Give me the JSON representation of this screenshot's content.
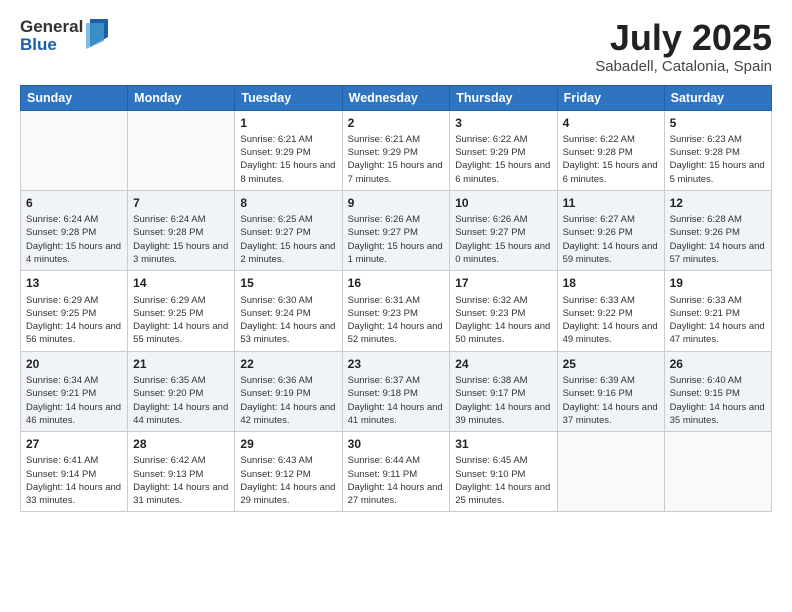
{
  "logo": {
    "general": "General",
    "blue": "Blue"
  },
  "title": {
    "month_year": "July 2025",
    "location": "Sabadell, Catalonia, Spain"
  },
  "headers": [
    "Sunday",
    "Monday",
    "Tuesday",
    "Wednesday",
    "Thursday",
    "Friday",
    "Saturday"
  ],
  "weeks": [
    [
      {
        "day": "",
        "info": ""
      },
      {
        "day": "",
        "info": ""
      },
      {
        "day": "1",
        "info": "Sunrise: 6:21 AM\nSunset: 9:29 PM\nDaylight: 15 hours and 8 minutes."
      },
      {
        "day": "2",
        "info": "Sunrise: 6:21 AM\nSunset: 9:29 PM\nDaylight: 15 hours and 7 minutes."
      },
      {
        "day": "3",
        "info": "Sunrise: 6:22 AM\nSunset: 9:29 PM\nDaylight: 15 hours and 6 minutes."
      },
      {
        "day": "4",
        "info": "Sunrise: 6:22 AM\nSunset: 9:28 PM\nDaylight: 15 hours and 6 minutes."
      },
      {
        "day": "5",
        "info": "Sunrise: 6:23 AM\nSunset: 9:28 PM\nDaylight: 15 hours and 5 minutes."
      }
    ],
    [
      {
        "day": "6",
        "info": "Sunrise: 6:24 AM\nSunset: 9:28 PM\nDaylight: 15 hours and 4 minutes."
      },
      {
        "day": "7",
        "info": "Sunrise: 6:24 AM\nSunset: 9:28 PM\nDaylight: 15 hours and 3 minutes."
      },
      {
        "day": "8",
        "info": "Sunrise: 6:25 AM\nSunset: 9:27 PM\nDaylight: 15 hours and 2 minutes."
      },
      {
        "day": "9",
        "info": "Sunrise: 6:26 AM\nSunset: 9:27 PM\nDaylight: 15 hours and 1 minute."
      },
      {
        "day": "10",
        "info": "Sunrise: 6:26 AM\nSunset: 9:27 PM\nDaylight: 15 hours and 0 minutes."
      },
      {
        "day": "11",
        "info": "Sunrise: 6:27 AM\nSunset: 9:26 PM\nDaylight: 14 hours and 59 minutes."
      },
      {
        "day": "12",
        "info": "Sunrise: 6:28 AM\nSunset: 9:26 PM\nDaylight: 14 hours and 57 minutes."
      }
    ],
    [
      {
        "day": "13",
        "info": "Sunrise: 6:29 AM\nSunset: 9:25 PM\nDaylight: 14 hours and 56 minutes."
      },
      {
        "day": "14",
        "info": "Sunrise: 6:29 AM\nSunset: 9:25 PM\nDaylight: 14 hours and 55 minutes."
      },
      {
        "day": "15",
        "info": "Sunrise: 6:30 AM\nSunset: 9:24 PM\nDaylight: 14 hours and 53 minutes."
      },
      {
        "day": "16",
        "info": "Sunrise: 6:31 AM\nSunset: 9:23 PM\nDaylight: 14 hours and 52 minutes."
      },
      {
        "day": "17",
        "info": "Sunrise: 6:32 AM\nSunset: 9:23 PM\nDaylight: 14 hours and 50 minutes."
      },
      {
        "day": "18",
        "info": "Sunrise: 6:33 AM\nSunset: 9:22 PM\nDaylight: 14 hours and 49 minutes."
      },
      {
        "day": "19",
        "info": "Sunrise: 6:33 AM\nSunset: 9:21 PM\nDaylight: 14 hours and 47 minutes."
      }
    ],
    [
      {
        "day": "20",
        "info": "Sunrise: 6:34 AM\nSunset: 9:21 PM\nDaylight: 14 hours and 46 minutes."
      },
      {
        "day": "21",
        "info": "Sunrise: 6:35 AM\nSunset: 9:20 PM\nDaylight: 14 hours and 44 minutes."
      },
      {
        "day": "22",
        "info": "Sunrise: 6:36 AM\nSunset: 9:19 PM\nDaylight: 14 hours and 42 minutes."
      },
      {
        "day": "23",
        "info": "Sunrise: 6:37 AM\nSunset: 9:18 PM\nDaylight: 14 hours and 41 minutes."
      },
      {
        "day": "24",
        "info": "Sunrise: 6:38 AM\nSunset: 9:17 PM\nDaylight: 14 hours and 39 minutes."
      },
      {
        "day": "25",
        "info": "Sunrise: 6:39 AM\nSunset: 9:16 PM\nDaylight: 14 hours and 37 minutes."
      },
      {
        "day": "26",
        "info": "Sunrise: 6:40 AM\nSunset: 9:15 PM\nDaylight: 14 hours and 35 minutes."
      }
    ],
    [
      {
        "day": "27",
        "info": "Sunrise: 6:41 AM\nSunset: 9:14 PM\nDaylight: 14 hours and 33 minutes."
      },
      {
        "day": "28",
        "info": "Sunrise: 6:42 AM\nSunset: 9:13 PM\nDaylight: 14 hours and 31 minutes."
      },
      {
        "day": "29",
        "info": "Sunrise: 6:43 AM\nSunset: 9:12 PM\nDaylight: 14 hours and 29 minutes."
      },
      {
        "day": "30",
        "info": "Sunrise: 6:44 AM\nSunset: 9:11 PM\nDaylight: 14 hours and 27 minutes."
      },
      {
        "day": "31",
        "info": "Sunrise: 6:45 AM\nSunset: 9:10 PM\nDaylight: 14 hours and 25 minutes."
      },
      {
        "day": "",
        "info": ""
      },
      {
        "day": "",
        "info": ""
      }
    ]
  ]
}
